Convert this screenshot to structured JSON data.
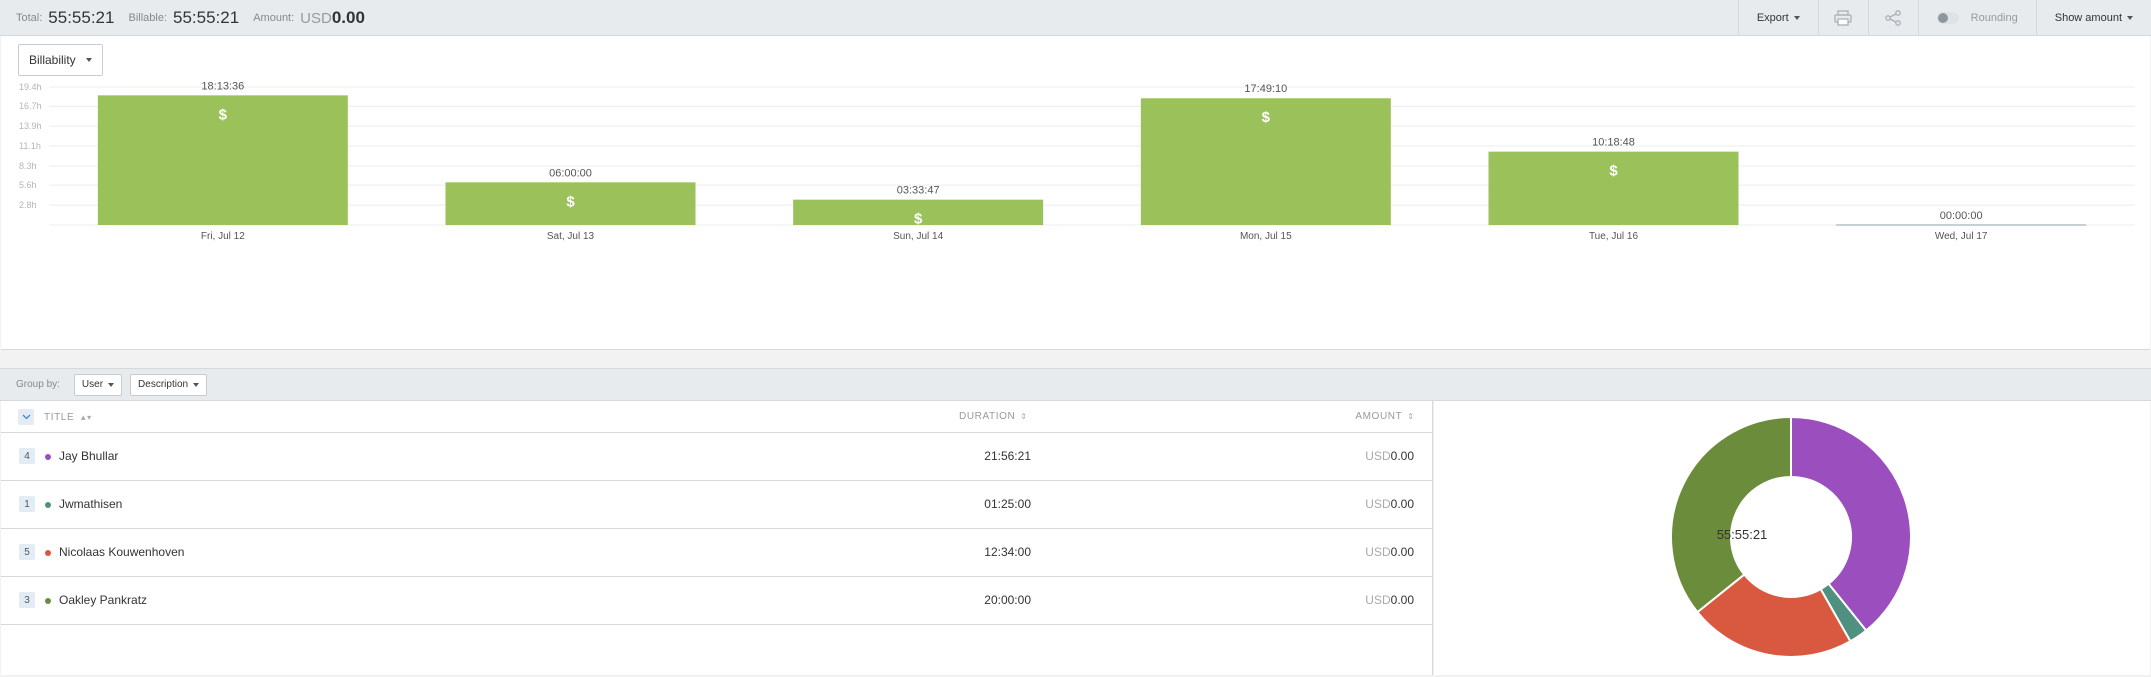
{
  "summary": {
    "total_label": "Total:",
    "total_value": "55:55:21",
    "billable_label": "Billable:",
    "billable_value": "55:55:21",
    "amount_label": "Amount:",
    "amount_currency": "USD",
    "amount_value": "0.00"
  },
  "toolbar": {
    "export_label": "Export",
    "print_icon": "print-icon",
    "share_icon": "share-icon",
    "rounding_label": "Rounding",
    "rounding_on": false,
    "show_amount_label": "Show amount"
  },
  "chart_controls": {
    "dropdown_label": "Billability"
  },
  "chart_data": {
    "type": "bar",
    "categories": [
      "Fri, Jul 12",
      "Sat, Jul 13",
      "Sun, Jul 14",
      "Mon, Jul 15",
      "Tue, Jul 16",
      "Wed, Jul 17"
    ],
    "values": [
      18.227,
      6.0,
      3.563,
      17.819,
      10.313,
      0.0
    ],
    "value_labels": [
      "18:13:36",
      "06:00:00",
      "03:33:47",
      "17:49:10",
      "10:18:48",
      "00:00:00"
    ],
    "y_ticks": [
      2.8,
      5.6,
      8.3,
      11.1,
      13.9,
      16.7,
      19.4
    ],
    "y_tick_labels": [
      "2.8h",
      "5.6h",
      "8.3h",
      "11.1h",
      "13.9h",
      "16.7h",
      "19.4h"
    ],
    "ylim": [
      0,
      19.4
    ],
    "bar_marker": "$",
    "bar_color": "#9bc25a",
    "grid": true
  },
  "group_by": {
    "label": "Group by:",
    "first": "User",
    "second": "Description"
  },
  "table": {
    "headers": {
      "title": "TITLE",
      "duration": "DURATION",
      "amount": "AMOUNT"
    },
    "rows": [
      {
        "count": "4",
        "name": "Jay Bhullar",
        "duration": "21:56:21",
        "currency": "USD",
        "amount": "0.00",
        "color": "#9b4fbf"
      },
      {
        "count": "1",
        "name": "Jwmathisen",
        "duration": "01:25:00",
        "currency": "USD",
        "amount": "0.00",
        "color": "#4f9080"
      },
      {
        "count": "5",
        "name": "Nicolaas Kouwenhoven",
        "duration": "12:34:00",
        "currency": "USD",
        "amount": "0.00",
        "color": "#d95940"
      },
      {
        "count": "3",
        "name": "Oakley Pankratz",
        "duration": "20:00:00",
        "currency": "USD",
        "amount": "0.00",
        "color": "#6b8c3a"
      }
    ]
  },
  "donut": {
    "center_label": "55:55:21",
    "slices": [
      {
        "name": "Jay Bhullar",
        "value": 21.939,
        "color": "#9b4fbf"
      },
      {
        "name": "Jwmathisen",
        "value": 1.417,
        "color": "#4f9080"
      },
      {
        "name": "Nicolaas Kouwenhoven",
        "value": 12.567,
        "color": "#d95940"
      },
      {
        "name": "Oakley Pankratz",
        "value": 20.0,
        "color": "#6b8c3a"
      }
    ]
  }
}
